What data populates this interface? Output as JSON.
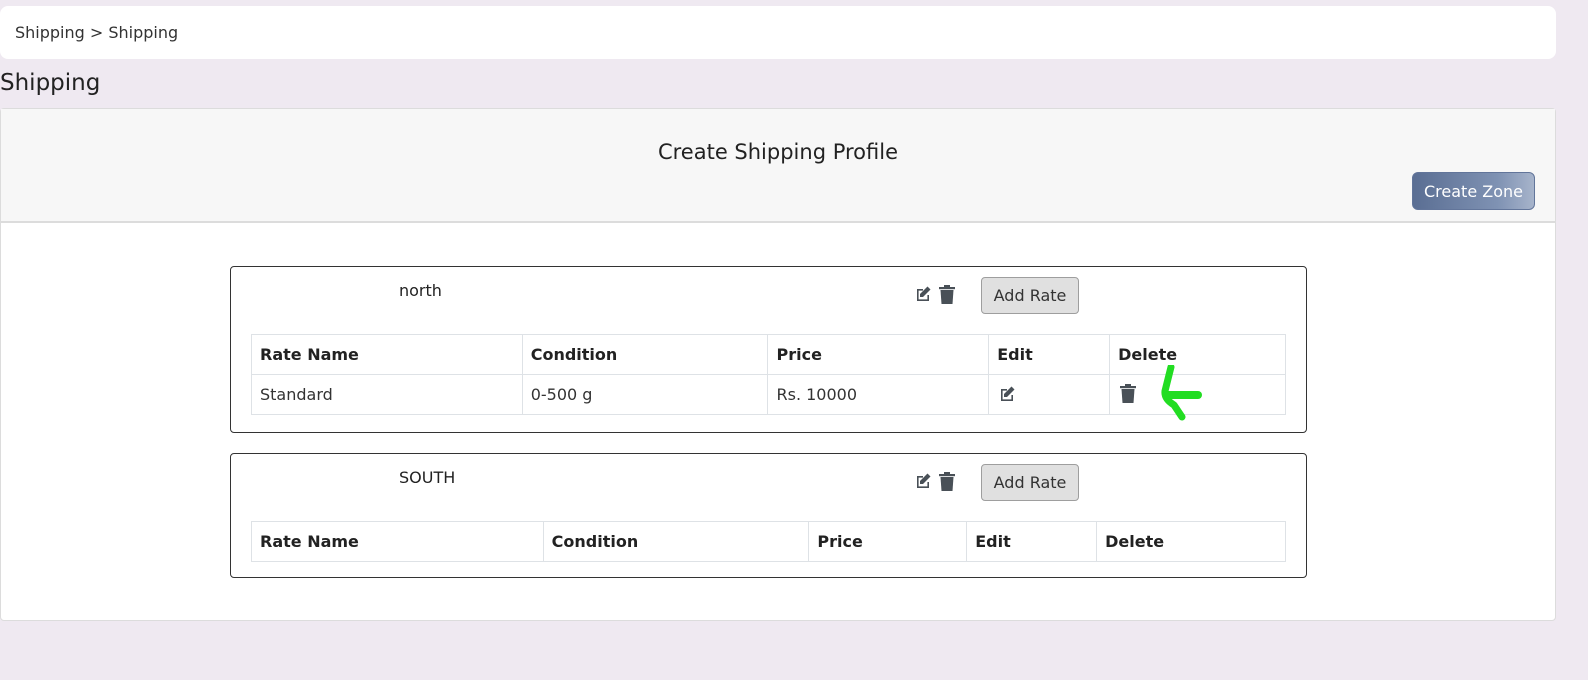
{
  "breadcrumb": {
    "text": "Shipping > Shipping"
  },
  "page": {
    "title": "Shipping"
  },
  "card": {
    "title": "Create Shipping Profile",
    "create_zone_label": "Create Zone"
  },
  "table_headers": [
    "Rate Name",
    "Condition",
    "Price",
    "Edit",
    "Delete"
  ],
  "zones": [
    {
      "name": "north",
      "add_rate_label": "Add Rate",
      "rates": [
        {
          "rate_name": "Standard",
          "condition": "0-500 g",
          "price": "Rs. 10000"
        }
      ]
    },
    {
      "name": "SOUTH",
      "add_rate_label": "Add Rate",
      "rates": []
    }
  ],
  "colors": {
    "accent_button": "#6b7ea2",
    "annotation_arrow": "#22dd22",
    "icon": "#495057"
  }
}
